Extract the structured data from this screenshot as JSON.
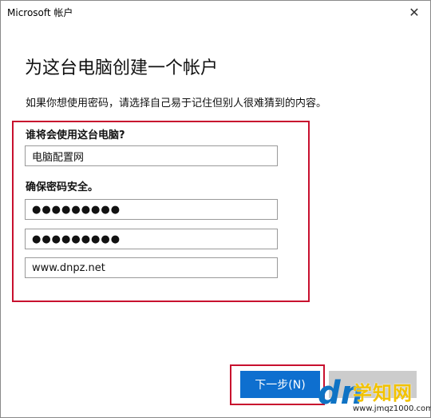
{
  "window": {
    "title": "Microsoft 帐户",
    "close_glyph": "✕"
  },
  "page": {
    "heading": "为这台电脑创建一个帐户",
    "description": "如果你想使用密码，请选择自己易于记住但别人很难猜到的内容。"
  },
  "form": {
    "who_label": "谁将会使用这台电脑?",
    "username_value": "电脑配置网",
    "secure_label": "确保密码安全。",
    "password_mask": "●●●●●●●●●",
    "confirm_password_mask": "●●●●●●●●●",
    "hint_value": "www.dnpz.net"
  },
  "buttons": {
    "next_label": "下一步(N)",
    "back_label": ""
  },
  "watermark": {
    "logo_text": "dn",
    "site_name": "学知网",
    "url": "www.jmqz1000.com"
  },
  "colors": {
    "accent": "#0e6fcf",
    "highlight": "#c8102e",
    "watermark_yellow": "#f2c200"
  }
}
